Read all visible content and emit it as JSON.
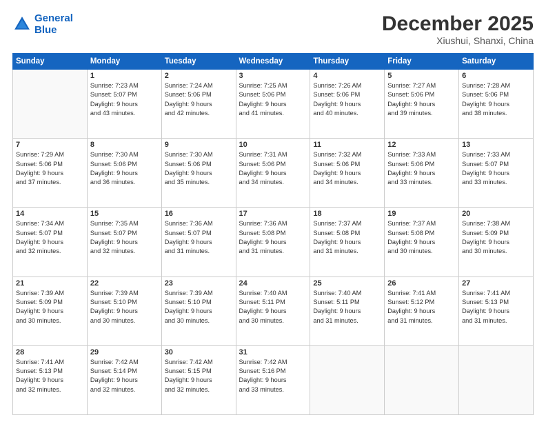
{
  "header": {
    "logo_line1": "General",
    "logo_line2": "Blue",
    "month": "December 2025",
    "location": "Xiushui, Shanxi, China"
  },
  "weekdays": [
    "Sunday",
    "Monday",
    "Tuesday",
    "Wednesday",
    "Thursday",
    "Friday",
    "Saturday"
  ],
  "weeks": [
    [
      {
        "day": "",
        "text": ""
      },
      {
        "day": "1",
        "text": "Sunrise: 7:23 AM\nSunset: 5:07 PM\nDaylight: 9 hours\nand 43 minutes."
      },
      {
        "day": "2",
        "text": "Sunrise: 7:24 AM\nSunset: 5:06 PM\nDaylight: 9 hours\nand 42 minutes."
      },
      {
        "day": "3",
        "text": "Sunrise: 7:25 AM\nSunset: 5:06 PM\nDaylight: 9 hours\nand 41 minutes."
      },
      {
        "day": "4",
        "text": "Sunrise: 7:26 AM\nSunset: 5:06 PM\nDaylight: 9 hours\nand 40 minutes."
      },
      {
        "day": "5",
        "text": "Sunrise: 7:27 AM\nSunset: 5:06 PM\nDaylight: 9 hours\nand 39 minutes."
      },
      {
        "day": "6",
        "text": "Sunrise: 7:28 AM\nSunset: 5:06 PM\nDaylight: 9 hours\nand 38 minutes."
      }
    ],
    [
      {
        "day": "7",
        "text": "Sunrise: 7:29 AM\nSunset: 5:06 PM\nDaylight: 9 hours\nand 37 minutes."
      },
      {
        "day": "8",
        "text": "Sunrise: 7:30 AM\nSunset: 5:06 PM\nDaylight: 9 hours\nand 36 minutes."
      },
      {
        "day": "9",
        "text": "Sunrise: 7:30 AM\nSunset: 5:06 PM\nDaylight: 9 hours\nand 35 minutes."
      },
      {
        "day": "10",
        "text": "Sunrise: 7:31 AM\nSunset: 5:06 PM\nDaylight: 9 hours\nand 34 minutes."
      },
      {
        "day": "11",
        "text": "Sunrise: 7:32 AM\nSunset: 5:06 PM\nDaylight: 9 hours\nand 34 minutes."
      },
      {
        "day": "12",
        "text": "Sunrise: 7:33 AM\nSunset: 5:06 PM\nDaylight: 9 hours\nand 33 minutes."
      },
      {
        "day": "13",
        "text": "Sunrise: 7:33 AM\nSunset: 5:07 PM\nDaylight: 9 hours\nand 33 minutes."
      }
    ],
    [
      {
        "day": "14",
        "text": "Sunrise: 7:34 AM\nSunset: 5:07 PM\nDaylight: 9 hours\nand 32 minutes."
      },
      {
        "day": "15",
        "text": "Sunrise: 7:35 AM\nSunset: 5:07 PM\nDaylight: 9 hours\nand 32 minutes."
      },
      {
        "day": "16",
        "text": "Sunrise: 7:36 AM\nSunset: 5:07 PM\nDaylight: 9 hours\nand 31 minutes."
      },
      {
        "day": "17",
        "text": "Sunrise: 7:36 AM\nSunset: 5:08 PM\nDaylight: 9 hours\nand 31 minutes."
      },
      {
        "day": "18",
        "text": "Sunrise: 7:37 AM\nSunset: 5:08 PM\nDaylight: 9 hours\nand 31 minutes."
      },
      {
        "day": "19",
        "text": "Sunrise: 7:37 AM\nSunset: 5:08 PM\nDaylight: 9 hours\nand 30 minutes."
      },
      {
        "day": "20",
        "text": "Sunrise: 7:38 AM\nSunset: 5:09 PM\nDaylight: 9 hours\nand 30 minutes."
      }
    ],
    [
      {
        "day": "21",
        "text": "Sunrise: 7:39 AM\nSunset: 5:09 PM\nDaylight: 9 hours\nand 30 minutes."
      },
      {
        "day": "22",
        "text": "Sunrise: 7:39 AM\nSunset: 5:10 PM\nDaylight: 9 hours\nand 30 minutes."
      },
      {
        "day": "23",
        "text": "Sunrise: 7:39 AM\nSunset: 5:10 PM\nDaylight: 9 hours\nand 30 minutes."
      },
      {
        "day": "24",
        "text": "Sunrise: 7:40 AM\nSunset: 5:11 PM\nDaylight: 9 hours\nand 30 minutes."
      },
      {
        "day": "25",
        "text": "Sunrise: 7:40 AM\nSunset: 5:11 PM\nDaylight: 9 hours\nand 31 minutes."
      },
      {
        "day": "26",
        "text": "Sunrise: 7:41 AM\nSunset: 5:12 PM\nDaylight: 9 hours\nand 31 minutes."
      },
      {
        "day": "27",
        "text": "Sunrise: 7:41 AM\nSunset: 5:13 PM\nDaylight: 9 hours\nand 31 minutes."
      }
    ],
    [
      {
        "day": "28",
        "text": "Sunrise: 7:41 AM\nSunset: 5:13 PM\nDaylight: 9 hours\nand 32 minutes."
      },
      {
        "day": "29",
        "text": "Sunrise: 7:42 AM\nSunset: 5:14 PM\nDaylight: 9 hours\nand 32 minutes."
      },
      {
        "day": "30",
        "text": "Sunrise: 7:42 AM\nSunset: 5:15 PM\nDaylight: 9 hours\nand 32 minutes."
      },
      {
        "day": "31",
        "text": "Sunrise: 7:42 AM\nSunset: 5:16 PM\nDaylight: 9 hours\nand 33 minutes."
      },
      {
        "day": "",
        "text": ""
      },
      {
        "day": "",
        "text": ""
      },
      {
        "day": "",
        "text": ""
      }
    ]
  ]
}
